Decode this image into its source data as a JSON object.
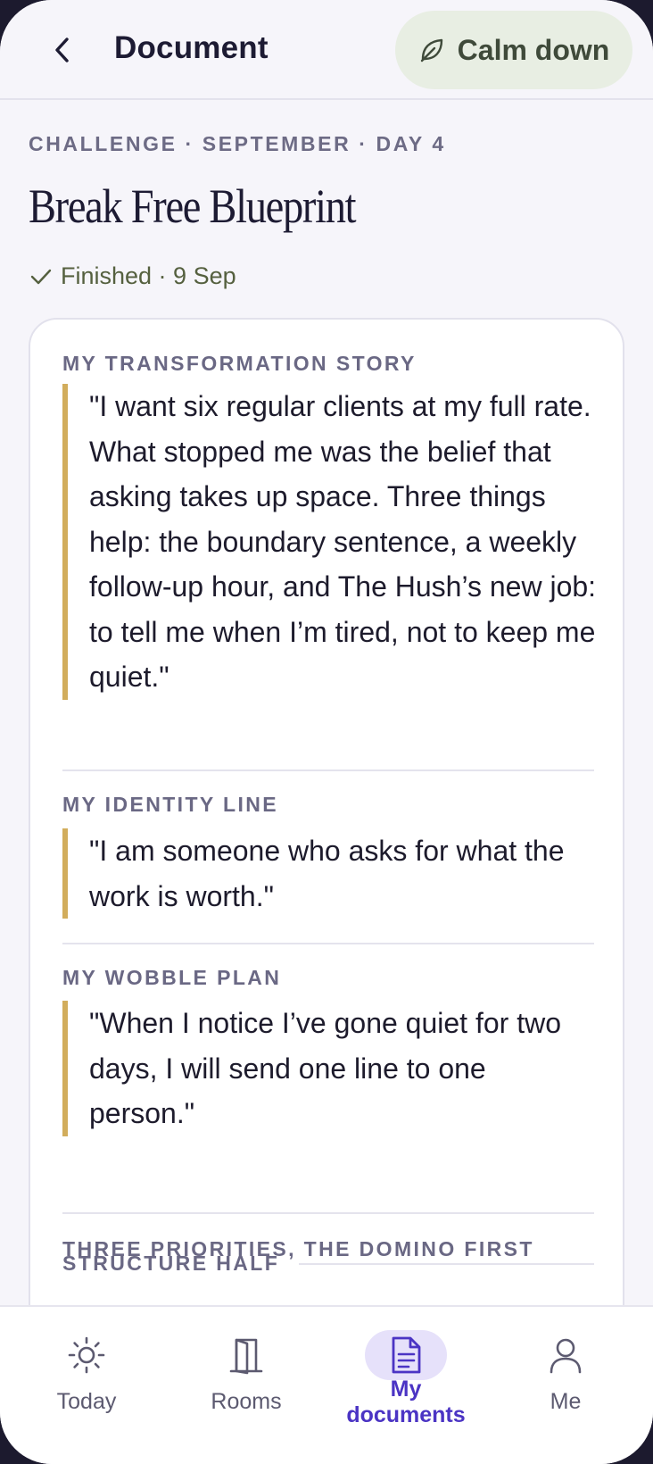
{
  "header": {
    "title": "Document",
    "calm_button": "Calm down"
  },
  "document": {
    "eyebrow": "CHALLENGE · SEPTEMBER · DAY 4",
    "title": "Break Free Blueprint",
    "status": "Finished · 9 Sep"
  },
  "sections": {
    "story": {
      "label": "MY TRANSFORMATION STORY",
      "text": "\"I want six regular clients at my full rate. What stopped me was the belief that asking takes up space. Three things help: the boundary sentence, a weekly follow-up hour, and The Hush’s new job: to tell me when I’m tired, not to keep me quiet.\""
    },
    "identity": {
      "label": "MY IDENTITY LINE",
      "text": "\"I am someone who asks for what the work is worth.\""
    },
    "wobble": {
      "label": "MY WOBBLE PLAN",
      "text": "\"When I notice I’ve gone quiet for two days, I will send one line to one person.\""
    },
    "structure": {
      "label": "STRUCTURE HALF"
    },
    "priorities": {
      "label": "THREE PRIORITIES, THE DOMINO FIRST"
    }
  },
  "nav": {
    "today": "Today",
    "rooms": "Rooms",
    "docs_line1": "My",
    "docs_line2": "documents",
    "me": "Me"
  },
  "colors": {
    "accent_gold": "#d2ad5c",
    "active_purple": "#4b34c4",
    "calm_bg": "#e8eee3"
  }
}
